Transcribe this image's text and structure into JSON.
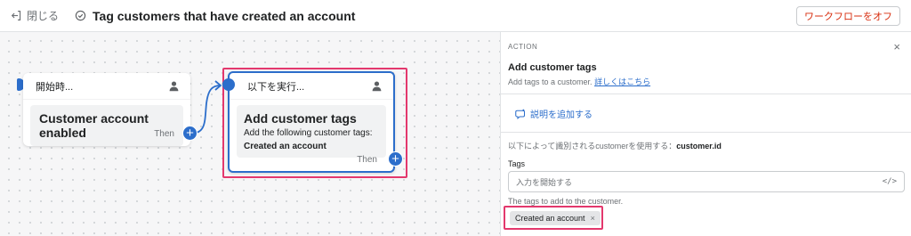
{
  "topbar": {
    "close_label": "閉じる",
    "title": "Tag customers that have created an account",
    "off_button": "ワークフローをオフ"
  },
  "trigger": {
    "header": "開始時...",
    "body_title": "Customer account enabled",
    "then_label": "Then"
  },
  "action": {
    "header": "以下を実行...",
    "body_title": "Add customer tags",
    "body_sub": "Add the following customer tags:",
    "body_value": "Created an account",
    "then_label": "Then"
  },
  "panel": {
    "section": "ACTION",
    "close": "×",
    "title": "Add customer tags",
    "desc": "Add tags to a customer.",
    "learn_more": "詳しくはこちら",
    "add_description": "説明を追加する",
    "ident_prefix": "以下によって識別されるcustomerを使用する：",
    "ident_value": "customer.id",
    "tags_label": "Tags",
    "input_placeholder": "入力を開始する",
    "input_code_icon": "</>",
    "help_text": "The tags to add to the customer.",
    "chip_label": "Created an account",
    "chip_remove": "×"
  },
  "colors": {
    "accent": "#2c6ecb",
    "highlight": "#e3386d",
    "danger": "#d72c0d"
  },
  "icons": [
    "exit-icon",
    "check-circle-icon",
    "person-icon",
    "plus-icon",
    "comment-icon",
    "code-icon",
    "close-icon"
  ]
}
